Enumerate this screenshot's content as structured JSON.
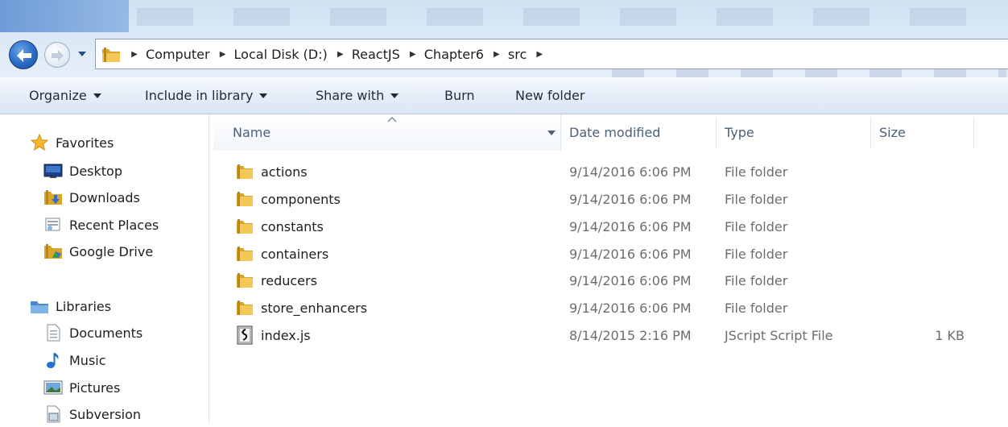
{
  "address_bar": {
    "breadcrumbs": [
      "Computer",
      "Local Disk (D:)",
      "ReactJS",
      "Chapter6",
      "src"
    ]
  },
  "command_bar": {
    "organize": "Organize",
    "include_in_library": "Include in library",
    "share_with": "Share with",
    "burn": "Burn",
    "new_folder": "New folder"
  },
  "nav_pane": {
    "favorites": {
      "label": "Favorites",
      "items": [
        {
          "label": "Desktop",
          "icon": "desktop-icon"
        },
        {
          "label": "Downloads",
          "icon": "downloads-folder-icon"
        },
        {
          "label": "Recent Places",
          "icon": "recent-places-icon"
        },
        {
          "label": "Google Drive",
          "icon": "google-drive-folder-icon"
        }
      ]
    },
    "libraries": {
      "label": "Libraries",
      "items": [
        {
          "label": "Documents",
          "icon": "documents-icon"
        },
        {
          "label": "Music",
          "icon": "music-icon"
        },
        {
          "label": "Pictures",
          "icon": "pictures-icon"
        },
        {
          "label": "Subversion",
          "icon": "subversion-icon"
        }
      ]
    }
  },
  "file_list": {
    "columns": {
      "name": "Name",
      "date_modified": "Date modified",
      "type": "Type",
      "size": "Size"
    },
    "sort_column": "Name",
    "rows": [
      {
        "name": "actions",
        "date": "9/14/2016 6:06 PM",
        "type": "File folder",
        "size": "",
        "icon": "folder-icon"
      },
      {
        "name": "components",
        "date": "9/14/2016 6:06 PM",
        "type": "File folder",
        "size": "",
        "icon": "folder-icon"
      },
      {
        "name": "constants",
        "date": "9/14/2016 6:06 PM",
        "type": "File folder",
        "size": "",
        "icon": "folder-icon"
      },
      {
        "name": "containers",
        "date": "9/14/2016 6:06 PM",
        "type": "File folder",
        "size": "",
        "icon": "folder-icon"
      },
      {
        "name": "reducers",
        "date": "9/14/2016 6:06 PM",
        "type": "File folder",
        "size": "",
        "icon": "folder-icon"
      },
      {
        "name": "store_enhancers",
        "date": "9/14/2016 6:06 PM",
        "type": "File folder",
        "size": "",
        "icon": "folder-icon"
      },
      {
        "name": "index.js",
        "date": "8/14/2015 2:16 PM",
        "type": "JScript Script File",
        "size": "1 KB",
        "icon": "jscript-file-icon"
      }
    ]
  },
  "colors": {
    "command_bar": "#dde8f4",
    "folder": "#e8b73a",
    "header_text": "#4c607a"
  }
}
